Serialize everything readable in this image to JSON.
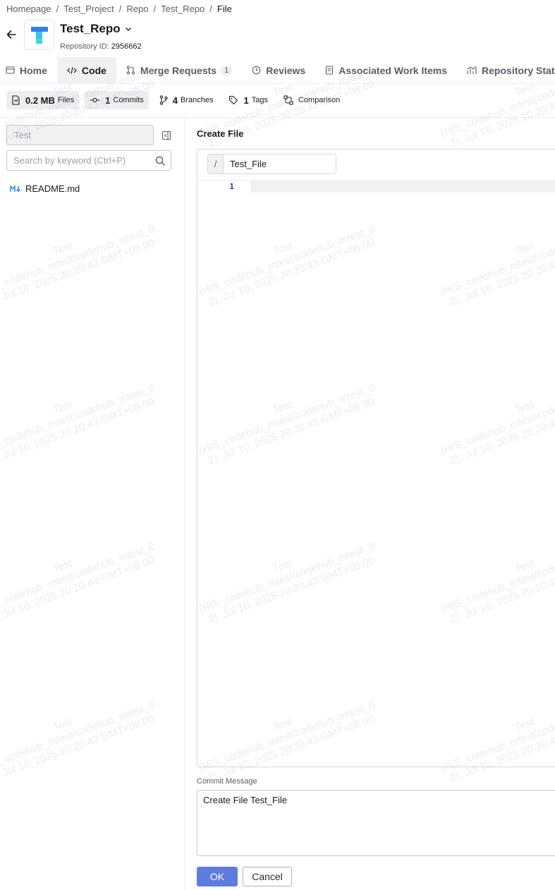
{
  "breadcrumb": {
    "items": [
      "Homepage",
      "Test_Project",
      "Repo",
      "Test_Repo"
    ],
    "current": "File",
    "separator": "/"
  },
  "repo": {
    "name": "Test_Repo",
    "id_label": "Repository ID:",
    "id_value": "2956662",
    "logo_icon": "repo-logo-t",
    "logo_colors": [
      "#2f80ed",
      "#3fc1f2",
      "#35e0d3"
    ]
  },
  "tabs": [
    {
      "label": "Home",
      "icon": "home-icon",
      "active": false
    },
    {
      "label": "Code",
      "icon": "code-icon",
      "active": true
    },
    {
      "label": "Merge Requests",
      "icon": "merge-request-icon",
      "count": "1",
      "active": false
    },
    {
      "label": "Reviews",
      "icon": "review-icon",
      "active": false
    },
    {
      "label": "Associated Work Items",
      "icon": "work-item-icon",
      "active": false
    },
    {
      "label": "Repository Statistics",
      "icon": "statistics-icon",
      "active": false
    }
  ],
  "stats": {
    "files": {
      "value": "0.2 MB",
      "label": "Files"
    },
    "commits": {
      "value": "1",
      "label": "Commits"
    },
    "branches": {
      "value": "4",
      "label": "Branches"
    },
    "tags": {
      "value": "1",
      "label": "Tags"
    },
    "comparison": {
      "label": "Comparison"
    }
  },
  "sidebar": {
    "branch": "Test",
    "search_placeholder": "Search by keyword (Ctrl+P)",
    "files": [
      {
        "name": "README.md",
        "icon": "markdown-icon"
      }
    ]
  },
  "editor": {
    "title": "Create File",
    "path_prefix": "/",
    "file_name": "Test_File",
    "line_numbers": [
      "1"
    ]
  },
  "commit": {
    "label": "Commit Message",
    "message": "Create File Test_File"
  },
  "buttons": {
    "ok": "OK",
    "cancel": "Cancel"
  },
  "watermark": {
    "line1": "Test",
    "line2": "(HIS_codehub_mtest/codehub_mtest_0",
    "line3": "2), Jul 10, 2025 20:20:43 GMT+08:00"
  },
  "colors": {
    "primary": "#5e7ce0",
    "line_number": "#1f3a93",
    "markdown": "#3c8fe8"
  }
}
